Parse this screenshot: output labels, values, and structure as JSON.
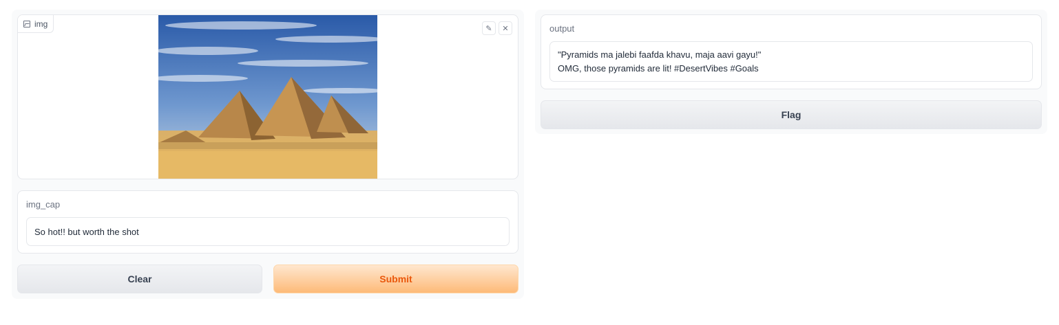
{
  "image_input": {
    "label": "img",
    "alt": "pyramids"
  },
  "caption_input": {
    "label": "img_cap",
    "value": "So hot!! but worth the shot"
  },
  "buttons": {
    "clear": "Clear",
    "submit": "Submit",
    "flag": "Flag"
  },
  "output": {
    "label": "output",
    "line1": "\"Pyramids ma jalebi faafda khavu, maja aavi gayu!\"",
    "line2": "OMG, those pyramids are lit! #DesertVibes #Goals"
  },
  "colors": {
    "primary_text": "#ea580c",
    "primary_bg": "#fdba78",
    "border": "#e5e7eb"
  },
  "icons": [
    "image-icon",
    "pencil-icon",
    "close-icon"
  ]
}
